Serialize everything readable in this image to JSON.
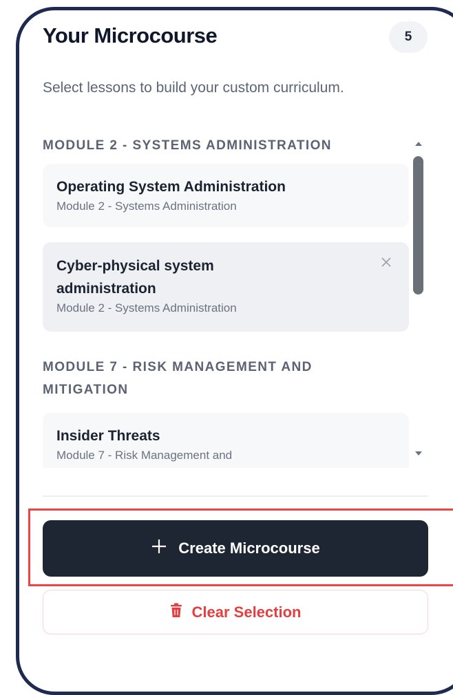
{
  "header": {
    "title": "Your Microcourse",
    "count": "5",
    "subtitle": "Select lessons to build your custom curriculum."
  },
  "modules": [
    {
      "heading": "MODULE 2 - SYSTEMS ADMINISTRATION",
      "lessons": [
        {
          "title": "Operating System Administration",
          "module": "Module 2 - Systems Administration"
        },
        {
          "title": "Cyber-physical system administration",
          "module": "Module 2 - Systems Administration"
        }
      ]
    },
    {
      "heading": "MODULE 7 - RISK MANAGEMENT AND MITIGATION",
      "lessons": [
        {
          "title": "Insider Threats",
          "module": "Module 7 - Risk Management and"
        }
      ]
    }
  ],
  "actions": {
    "create_label": "Create Microcourse",
    "clear_label": "Clear Selection"
  },
  "icons": {
    "create": "plus-icon",
    "clear": "trash-icon",
    "remove": "close-icon"
  },
  "colors": {
    "frame": "#1e2a4f",
    "primary_button": "#1f2633",
    "danger": "#e53e3e",
    "highlight": "#ef4444"
  }
}
